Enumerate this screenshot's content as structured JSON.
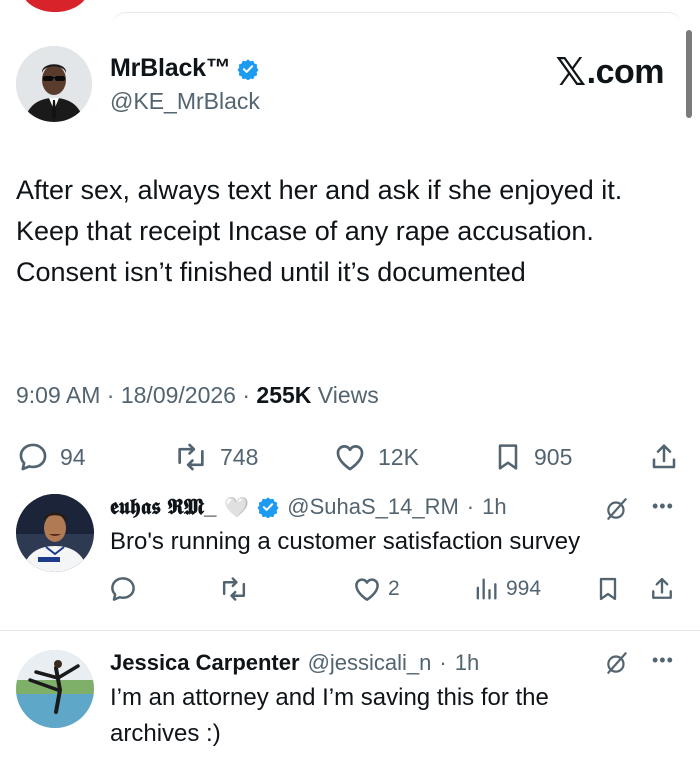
{
  "main_tweet": {
    "name": "MrBlack™",
    "handle": "@KE_MrBlack",
    "brand": "X.com",
    "brand_x": "𝕏",
    "brand_suffix": ".com",
    "text": "After sex, always text her and ask if she enjoyed it. Keep that receipt Incase of any rape accusation. Consent isn’t finished until it’s documented",
    "time": "9:09 AM",
    "date": "18/09/2026",
    "views_count": "255K",
    "views_label": "Views",
    "separator": "·",
    "stats": {
      "replies": "94",
      "reposts": "748",
      "likes": "12K",
      "bookmarks": "905"
    }
  },
  "replies": [
    {
      "name": "𝖊𝖚𝖍𝖆𝖘 𝕽𝕸_",
      "name_suffix": "🤍",
      "handle": "@SuhaS_14_RM",
      "time": "1h",
      "text": "Bro's running a customer satisfaction survey",
      "stats": {
        "replies": "",
        "reposts": "",
        "likes": "2",
        "views": "994"
      },
      "verified": true
    },
    {
      "name": "Jessica Carpenter",
      "handle": "@jessicali_n",
      "time": "1h",
      "text": "I’m an attorney and I’m saving this for the archives :)",
      "verified": false
    }
  ],
  "colors": {
    "verified_blue": "#1d9bf0",
    "muted": "#536471",
    "text": "#0f1419",
    "divider": "#e6e9ec"
  },
  "icons": [
    "reply-icon",
    "repost-icon",
    "like-icon",
    "bookmark-icon",
    "share-icon",
    "views-icon",
    "grok-icon",
    "more-icon",
    "verified-badge-icon"
  ]
}
